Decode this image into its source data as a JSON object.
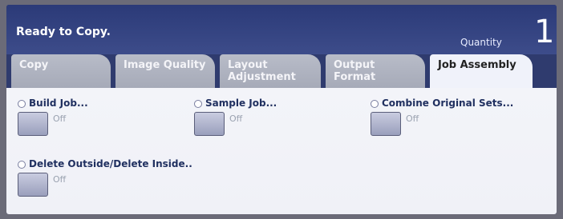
{
  "header": {
    "status": "Ready to Copy.",
    "quantity_label": "Quantity",
    "quantity_value": "1"
  },
  "tabs": [
    {
      "label_line1": "Copy",
      "label_line2": "",
      "active": false
    },
    {
      "label_line1": "Image Quality",
      "label_line2": "",
      "active": false
    },
    {
      "label_line1": "Layout",
      "label_line2": "Adjustment",
      "active": false
    },
    {
      "label_line1": "Output Format",
      "label_line2": "",
      "active": false
    },
    {
      "label_line1": "Job Assembly",
      "label_line2": "",
      "active": true
    }
  ],
  "options": [
    {
      "label": "Build Job...",
      "value": "Off"
    },
    {
      "label": "Sample Job...",
      "value": "Off"
    },
    {
      "label": "Combine Original Sets...",
      "value": "Off"
    },
    {
      "label": "Delete Outside/Delete Inside..",
      "value": "Off"
    }
  ]
}
